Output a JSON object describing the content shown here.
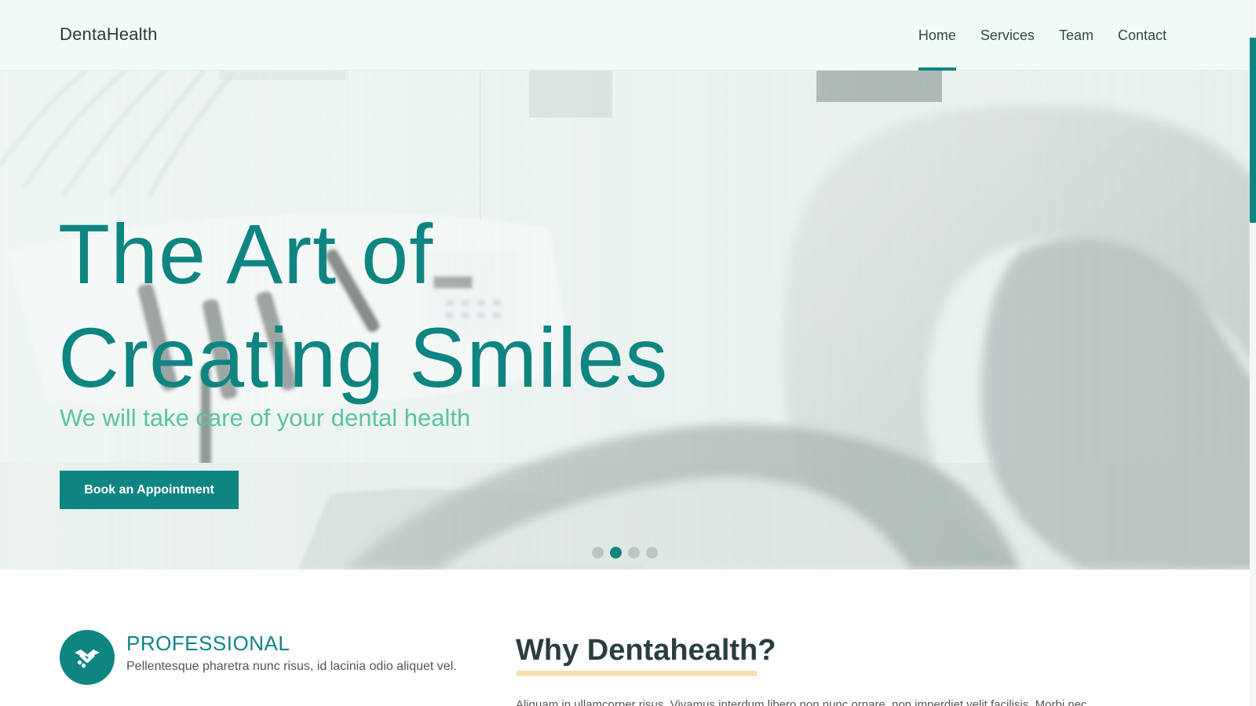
{
  "brand": {
    "name": "DentaHealth"
  },
  "nav": {
    "items": [
      {
        "label": "Home",
        "active": true
      },
      {
        "label": "Services",
        "active": false
      },
      {
        "label": "Team",
        "active": false
      },
      {
        "label": "Contact",
        "active": false
      }
    ]
  },
  "hero": {
    "title_line1": "The Art of",
    "title_line2": "Creating Smiles",
    "subtitle": "We will take care of your dental health",
    "cta_label": "Book an Appointment",
    "carousel": {
      "slide_count": 4,
      "active_index": 1
    }
  },
  "feature": {
    "icon": "handshake-icon",
    "title": "PROFESSIONAL",
    "text": "Pellentesque pharetra nunc risus, id lacinia odio aliquet vel."
  },
  "why": {
    "title": "Why Dentahealth?",
    "text": "Aliquam in ullamcorper risus. Vivamus interdum libero non nunc ornare, non imperdiet velit facilisis. Morbi nec"
  },
  "colors": {
    "accent": "#0f8582",
    "subtitle": "#5cc3a2",
    "header_bg": "#f1fcf7",
    "underline": "#f5dfae"
  }
}
